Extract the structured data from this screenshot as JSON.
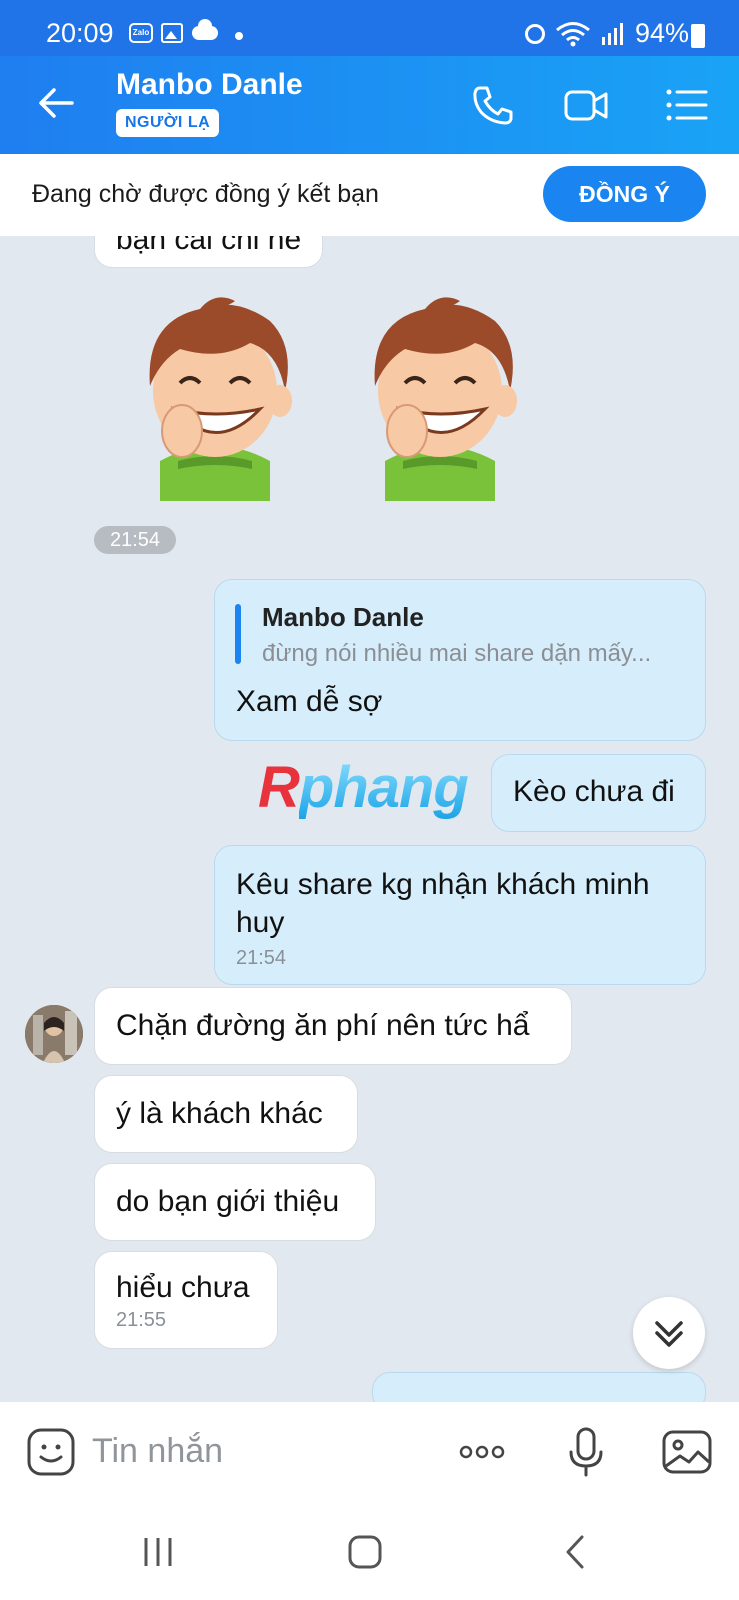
{
  "status_bar": {
    "time": "20:09",
    "battery": "94%",
    "icons": [
      "zalo-icon",
      "gallery-icon",
      "cloud-icon",
      "alarm-icon",
      "wifi-icon",
      "signal-icon",
      "battery-icon"
    ]
  },
  "header": {
    "contact_name": "Manbo Danle",
    "badge": "NGƯỜI LẠ",
    "icons": [
      "back-arrow-icon",
      "phone-icon",
      "video-call-icon",
      "menu-icon"
    ]
  },
  "friend_request": {
    "text": "Đang chờ được đồng ý kết bạn",
    "accept_label": "ĐỒNG Ý"
  },
  "messages": {
    "m0_partial": "bạn cái chỉ nè",
    "time_divider": "21:54",
    "quote": {
      "name": "Manbo Danle",
      "text": "đừng nói nhiều mai share dặn mấy...",
      "reply": "Xam dễ sợ"
    },
    "m_keo": "Kèo chưa đi",
    "m_keu": "Kêu share kg nhận khách minh huy",
    "m_keu_time": "21:54",
    "m_chan": "Chặn đường ăn phí nên tức hẩ",
    "m_y": "ý là khách khác",
    "m_do": "do bạn giới thiệu",
    "m_hieu": "hiểu chưa",
    "m_hieu_time": "21:55"
  },
  "watermark": {
    "first": "R",
    "rest": "phang"
  },
  "composer": {
    "placeholder": "Tin nhắn"
  },
  "colors": {
    "brand": "#1a84f0",
    "outgoing_bubble": "#d6eefc",
    "chat_bg": "#e2e8ef"
  }
}
